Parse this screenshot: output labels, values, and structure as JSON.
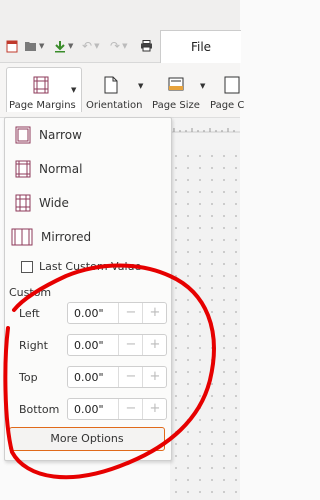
{
  "toolbar": {
    "file_tab": "File"
  },
  "ribbon": {
    "page_margins": "Page Margins",
    "orientation": "Orientation",
    "page_size": "Page Size",
    "page_columns": "Page C"
  },
  "margins_menu": {
    "items": [
      {
        "label": "Narrow",
        "icon": "narrow-margins-icon"
      },
      {
        "label": "Normal",
        "icon": "normal-margins-icon"
      },
      {
        "label": "Wide",
        "icon": "wide-margins-icon"
      },
      {
        "label": "Mirrored",
        "icon": "mirrored-margins-icon"
      }
    ],
    "last_custom_label": "Last Custom Value",
    "custom_heading": "Custom",
    "fields": [
      {
        "label": "Left",
        "value": "0.00\""
      },
      {
        "label": "Right",
        "value": "0.00\""
      },
      {
        "label": "Top",
        "value": "0.00\""
      },
      {
        "label": "Bottom",
        "value": "0.00\""
      }
    ],
    "more_options": "More Options"
  },
  "colors": {
    "accent_orange": "#e06a1a",
    "annotation_red": "#e60000"
  }
}
